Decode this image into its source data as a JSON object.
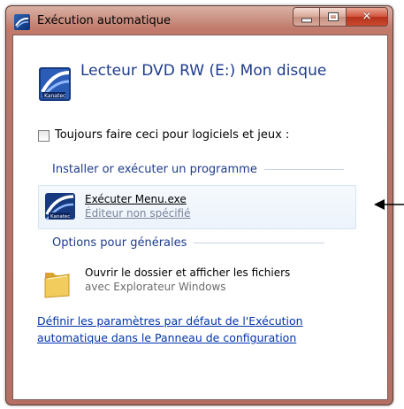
{
  "window": {
    "title": "Exécution automatique",
    "buttons": {
      "minimize": "minimize",
      "maximize": "maximize",
      "close": "close"
    }
  },
  "device": {
    "title": "Lecteur DVD RW (E:) Mon disque",
    "icon": "kanatec-dvd-icon"
  },
  "checkbox": {
    "label": "Toujours faire ceci pour logiciels et jeux :",
    "checked": false
  },
  "sections": [
    {
      "header": "Installer or exécuter un programme",
      "items": [
        {
          "title": "Exécuter Menu.exe",
          "subtitle": "Éditeur non spécifié",
          "icon": "program-icon",
          "selected": true
        }
      ]
    },
    {
      "header": "Options pour générales",
      "items": [
        {
          "title": "Ouvrir le dossier et afficher les fichiers",
          "subtitle": "avec Explorateur Windows",
          "icon": "folder-icon",
          "selected": false
        }
      ]
    }
  ],
  "footer_link": "Définir les paramètres par défaut de l'Exécution automatique dans le Panneau de configuration",
  "colors": {
    "frame": "#b56f65",
    "heading_blue": "#1e3c8c",
    "link_blue": "#0033aa",
    "selection_bg": "#edf3fb"
  }
}
